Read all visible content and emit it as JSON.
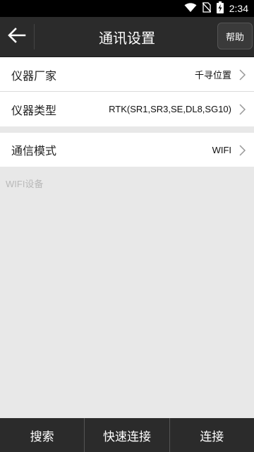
{
  "status_bar": {
    "time": "2:34",
    "icons": [
      "wifi-icon",
      "no-sim-icon",
      "battery-charging-icon"
    ]
  },
  "app_bar": {
    "back_icon": "arrow-left-icon",
    "title": "通讯设置",
    "help_label": "帮助"
  },
  "settings": {
    "manufacturer": {
      "label": "仪器厂家",
      "value": "千寻位置"
    },
    "device_type": {
      "label": "仪器类型",
      "value": "RTK(SR1,SR3,SE,DL8,SG10)"
    },
    "comm_mode": {
      "label": "通信模式",
      "value": "WIFI"
    }
  },
  "wifi_section": {
    "label": "WIFI设备"
  },
  "bottom_bar": {
    "search_label": "搜索",
    "quick_connect_label": "快速连接",
    "connect_label": "连接"
  },
  "colors": {
    "app_bar_bg": "#2b2b2b",
    "page_bg": "#e8e8e8",
    "row_bg": "#ffffff"
  }
}
